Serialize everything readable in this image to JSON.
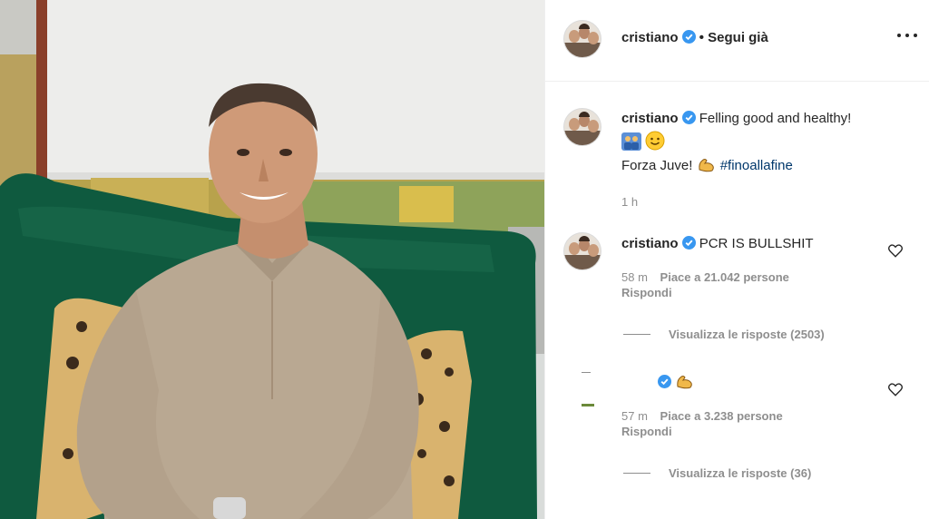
{
  "post": {
    "username": "cristiano",
    "follow_state": "Segui già",
    "more_icon": "more-options-icon",
    "caption": {
      "username": "cristiano",
      "text_line1": "Felling good and healthy!",
      "emojis_line2": [
        "people-icon",
        "smiling-face-icon"
      ],
      "text_line3": "Forza Juve!",
      "emoji_line3": "flexed-biceps-icon",
      "hashtag": "#finoallafine",
      "time": "1 h"
    },
    "comments": [
      {
        "username": "cristiano",
        "text": "PCR IS BULLSHIT",
        "time": "58 m",
        "likes": "Piace a 21.042 persone",
        "reply": "Rispondi",
        "view_replies": "Visualizza le risposte (2503)"
      },
      {
        "username": "",
        "emoji": "flexed-biceps-icon",
        "time": "57 m",
        "likes": "Piace a 3.238 persone",
        "reply": "Rispondi",
        "view_replies": "Visualizza le risposte (36)"
      }
    ],
    "colors": {
      "verified": "#3897f0",
      "text": "#262626",
      "muted": "#8e8e8e",
      "hashtag": "#00376b",
      "sofa": "#0f5a3f",
      "shirt": "#b9a892"
    }
  }
}
